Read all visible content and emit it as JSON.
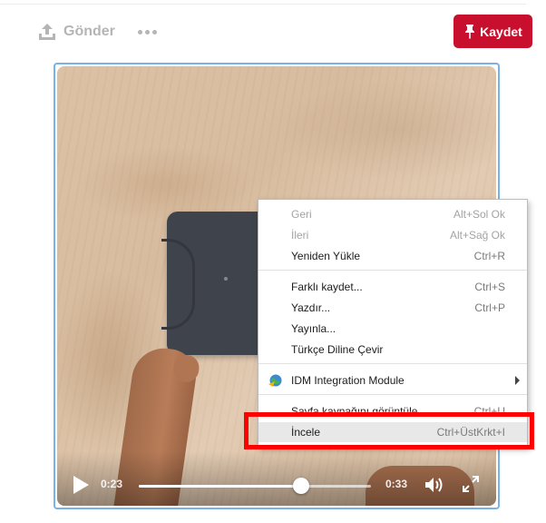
{
  "header": {
    "send_label": "Gönder",
    "save_label": "Kaydet",
    "icons": {
      "send": "upload-icon",
      "more": "more-dots-icon",
      "save": "pin-icon"
    }
  },
  "video": {
    "current_time": "0:23",
    "total_time": "0:33",
    "progress": 0.7,
    "icons": {
      "play": "play-icon",
      "volume": "volume-icon",
      "fullscreen": "fullscreen-icon"
    }
  },
  "context_menu": {
    "items": [
      {
        "label": "Geri",
        "shortcut": "Alt+Sol Ok",
        "disabled": true
      },
      {
        "label": "İleri",
        "shortcut": "Alt+Sağ Ok",
        "disabled": true
      },
      {
        "label": "Yeniden Yükle",
        "shortcut": "Ctrl+R",
        "disabled": false
      },
      {
        "label": "Farklı kaydet...",
        "shortcut": "Ctrl+S",
        "disabled": false
      },
      {
        "label": "Yazdır...",
        "shortcut": "Ctrl+P",
        "disabled": false
      },
      {
        "label": "Yayınla...",
        "shortcut": "",
        "disabled": false
      },
      {
        "label": "Türkçe Diline Çevir",
        "shortcut": "",
        "disabled": false
      },
      {
        "label": "IDM Integration Module",
        "shortcut": "",
        "disabled": false,
        "icon": "idm-globe-icon",
        "submenu": true
      },
      {
        "label": "Sayfa kaynağını görüntüle",
        "shortcut": "Ctrl+U",
        "disabled": false
      },
      {
        "label": "İncele",
        "shortcut": "Ctrl+ÜstKrkt+I",
        "disabled": false,
        "highlighted": true
      }
    ]
  },
  "colors": {
    "save_button": "#c8102e",
    "highlight_border": "#ff0000",
    "video_border": "#79b2e6"
  }
}
